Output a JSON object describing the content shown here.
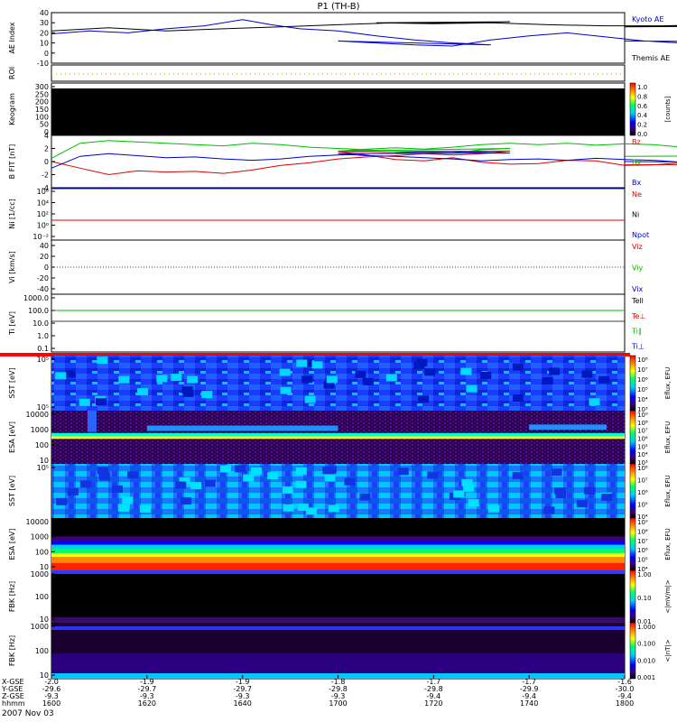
{
  "title": "P1 (TH-B)",
  "date_label": "2007 Nov 03",
  "colors": {
    "blue": "#0000cc",
    "red": "#dd0000",
    "green": "#00bb00",
    "black": "#000000",
    "orange": "#ff9900"
  },
  "chart_data": {
    "type": "multi-panel",
    "panels": [
      {
        "id": "ae",
        "ylabel": "AE Index",
        "ylim": [
          -10,
          40
        ],
        "ticks": [
          "40",
          "30",
          "20",
          "10",
          "0",
          "-10"
        ],
        "tick_values": [
          40,
          30,
          20,
          10,
          0,
          -10
        ],
        "legend": [
          "Kyoto AE",
          "Themis AE"
        ],
        "series": [
          {
            "name": "Kyoto AE",
            "color": "blue",
            "t": [
              1600,
              1608,
              1616,
              1624,
              1632,
              1640,
              1646,
              1652,
              1660,
              1668,
              1676,
              1684,
              1692,
              1700,
              1708,
              1716,
              1724,
              1732,
              1740,
              1748,
              1756,
              1764,
              1772,
              1780,
              1788,
              1796,
              1800
            ],
            "v": [
              19,
              22,
              20,
              24,
              27,
              33,
              28,
              24,
              22,
              17,
              13,
              10,
              8,
              12,
              10,
              8,
              7,
              13,
              17,
              20,
              16,
              12,
              10,
              8,
              9,
              11,
              12
            ]
          },
          {
            "name": "Themis AE",
            "color": "black",
            "t": [
              1600,
              1612,
              1624,
              1636,
              1648,
              1660,
              1672,
              1684,
              1696,
              1708,
              1720,
              1732,
              1744,
              1756,
              1768,
              1780,
              1792,
              1800
            ],
            "v": [
              22,
              25,
              22,
              24,
              26,
              28,
              30,
              30,
              31,
              30,
              29,
              30,
              28,
              27,
              27,
              28,
              27,
              26
            ]
          }
        ]
      },
      {
        "id": "roi",
        "ylabel": "ROI"
      },
      {
        "id": "keogram",
        "ylabel": "Keogram",
        "ticks": [
          "300",
          "250",
          "200",
          "150",
          "100",
          "50",
          "0"
        ],
        "colorbar_ticks": [
          "1.0",
          "0.8",
          "0.6",
          "0.4",
          "0.2",
          "0.0"
        ],
        "colorbar_label": "[counts]"
      },
      {
        "id": "bfield",
        "ylabel": "B FIT [nT]",
        "ylim": [
          -4,
          4
        ],
        "ticks": [
          "4",
          "2",
          "0",
          "-2",
          "-4"
        ],
        "tick_values": [
          4,
          2,
          0,
          -2,
          -4
        ],
        "legend": [
          "Bz",
          "By",
          "Bx"
        ],
        "series": [
          {
            "name": "Bz",
            "color": "red",
            "t": [
              1600,
              1606,
              1612,
              1618,
              1624,
              1630,
              1636,
              1642,
              1648,
              1654,
              1660,
              1666,
              1672,
              1678,
              1684,
              1690,
              1696,
              1700,
              1706,
              1712,
              1718,
              1724,
              1730,
              1736,
              1742,
              1748,
              1754,
              1760,
              1766,
              1772,
              1778,
              1784,
              1790,
              1796,
              1800
            ],
            "v": [
              0,
              -1,
              -2,
              -1.4,
              -1.6,
              -1.5,
              -1.8,
              -1.3,
              -0.6,
              -0.2,
              0.4,
              0.7,
              0.9,
              1.2,
              1.0,
              1.2,
              1.6,
              1.5,
              1.0,
              0.3,
              0.1,
              0.6,
              -0.1,
              -0.4,
              -0.3,
              0.2,
              0.1,
              -0.6,
              -0.5,
              -0.2,
              -0.3,
              -0.7,
              -0.6,
              -0.4,
              -0.5
            ]
          },
          {
            "name": "By",
            "color": "green",
            "t": [
              1600,
              1606,
              1612,
              1618,
              1624,
              1630,
              1636,
              1642,
              1648,
              1654,
              1660,
              1666,
              1672,
              1678,
              1684,
              1690,
              1696,
              1700,
              1706,
              1712,
              1718,
              1724,
              1730,
              1736,
              1742,
              1748,
              1754,
              1760,
              1766,
              1772,
              1778,
              1784,
              1790,
              1796,
              1800
            ],
            "v": [
              0.5,
              2.8,
              3.2,
              3.0,
              2.8,
              2.6,
              2.4,
              2.8,
              2.6,
              2.2,
              2.0,
              1.8,
              1.5,
              1.4,
              1.3,
              1.8,
              2.0,
              1.6,
              1.9,
              2.1,
              1.9,
              2.2,
              2.6,
              2.8,
              2.6,
              2.8,
              2.5,
              2.7,
              2.6,
              2.2,
              1.6,
              1.4,
              1.1,
              0.9,
              0.8
            ]
          },
          {
            "name": "Bx",
            "color": "blue",
            "t": [
              1600,
              1606,
              1612,
              1618,
              1624,
              1630,
              1636,
              1642,
              1648,
              1654,
              1660,
              1666,
              1672,
              1678,
              1684,
              1690,
              1696,
              1700,
              1706,
              1712,
              1718,
              1724,
              1730,
              1736,
              1742,
              1748,
              1754,
              1760,
              1766,
              1772,
              1778,
              1784,
              1790,
              1796,
              1800
            ],
            "v": [
              -1,
              0.8,
              1.2,
              0.9,
              0.6,
              0.7,
              0.4,
              0.2,
              0.4,
              0.8,
              1.0,
              1.2,
              1.3,
              1.5,
              1.5,
              1.4,
              1.3,
              1.2,
              0.9,
              0.8,
              0.6,
              0.4,
              0.1,
              0.3,
              0.4,
              0.2,
              0.5,
              0.3,
              0.2,
              -0.1,
              0.0,
              -0.2,
              -0.3,
              -0.2,
              0.0
            ]
          }
        ]
      },
      {
        "id": "density",
        "ylabel": "Ni [1/cc]",
        "ticks": [
          "10⁶",
          "10⁴",
          "10²",
          "10⁰",
          "10⁻²"
        ],
        "legend": [
          "Ne",
          "Ni",
          "Npot"
        ]
      },
      {
        "id": "velocity",
        "ylabel": "Vi [km/s]",
        "ylim": [
          -50,
          50
        ],
        "ticks": [
          "40",
          "20",
          "0",
          "-20",
          "-40"
        ],
        "tick_values": [
          40,
          20,
          0,
          -20,
          -40
        ],
        "legend": [
          "Viz",
          "Viy",
          "Vix"
        ]
      },
      {
        "id": "temperature",
        "ylabel": "Ti [eV]",
        "ticks": [
          "1000.0",
          "100.0",
          "10.0",
          "1.0",
          "0.1"
        ],
        "legend": [
          "Tell",
          "Te⊥",
          "Ti∥",
          "Ti⊥"
        ]
      },
      {
        "id": "sst1",
        "ylabel": "SST [eV]",
        "ticks": [
          "10⁵",
          "10⁵"
        ],
        "colorbar_ticks": [
          "10⁸",
          "10⁷",
          "10⁶",
          "10⁵",
          "10⁴",
          "10³"
        ],
        "colorbar_label": "Eflux, EFU"
      },
      {
        "id": "esa1",
        "ylabel": "ESA [eV]",
        "ticks": [
          "10000",
          "1000",
          "100",
          "10"
        ],
        "colorbar_ticks": [
          "10⁹",
          "10⁸",
          "10⁷",
          "10⁶",
          "10⁵",
          "10⁴",
          "10³"
        ],
        "colorbar_label": "Eflux, EFU"
      },
      {
        "id": "sst2",
        "ylabel": "SST [eV]",
        "ticks": [
          "10⁵"
        ],
        "colorbar_ticks": [
          "10⁸",
          "10⁷",
          "10⁶",
          "10⁵",
          "10⁴"
        ],
        "colorbar_label": "Eflux, EFU"
      },
      {
        "id": "esa2",
        "ylabel": "ESA [eV]",
        "ticks": [
          "10000",
          "1000",
          "100",
          "10"
        ],
        "colorbar_ticks": [
          "10⁹",
          "10⁸",
          "10⁷",
          "10⁶",
          "10⁵",
          "10⁴"
        ],
        "colorbar_label": "Eflux, EFU"
      },
      {
        "id": "fbk1",
        "ylabel": "FBK [Hz]",
        "ticks": [
          "1000",
          "100",
          "10"
        ],
        "colorbar_ticks": [
          "1.00",
          "0.10",
          "0.01"
        ],
        "colorbar_label": "<|mV/m|>"
      },
      {
        "id": "fbk2",
        "ylabel": "FBK [Hz]",
        "ticks": [
          "1000",
          "100",
          "10"
        ],
        "colorbar_ticks": [
          "1.000",
          "0.100",
          "0.010",
          "0.001"
        ],
        "colorbar_label": "<|nT|>"
      }
    ],
    "x_axis": {
      "row_labels": [
        "X-GSE",
        "Y-GSE",
        "Z-GSE",
        "hhmm"
      ],
      "ticks": [
        {
          "t": 1600,
          "rows": [
            "-2.0",
            "-29.6",
            "-9.3",
            "1600"
          ]
        },
        {
          "t": 1620,
          "rows": [
            "-1.9",
            "-29.7",
            "-9.3",
            "1620"
          ]
        },
        {
          "t": 1640,
          "rows": [
            "-1.9",
            "-29.7",
            "-9.3",
            "1640"
          ]
        },
        {
          "t": 1700,
          "rows": [
            "-1.8",
            "-29.8",
            "-9.3",
            "1700"
          ]
        },
        {
          "t": 1720,
          "rows": [
            "-1.7",
            "-29.8",
            "-9.4",
            "1720"
          ]
        },
        {
          "t": 1740,
          "rows": [
            "-1.7",
            "-29.9",
            "-9.4",
            "1740"
          ]
        },
        {
          "t": 1800,
          "rows": [
            "-1.6",
            "-30.0",
            "-9.4",
            "1800"
          ]
        }
      ]
    }
  }
}
